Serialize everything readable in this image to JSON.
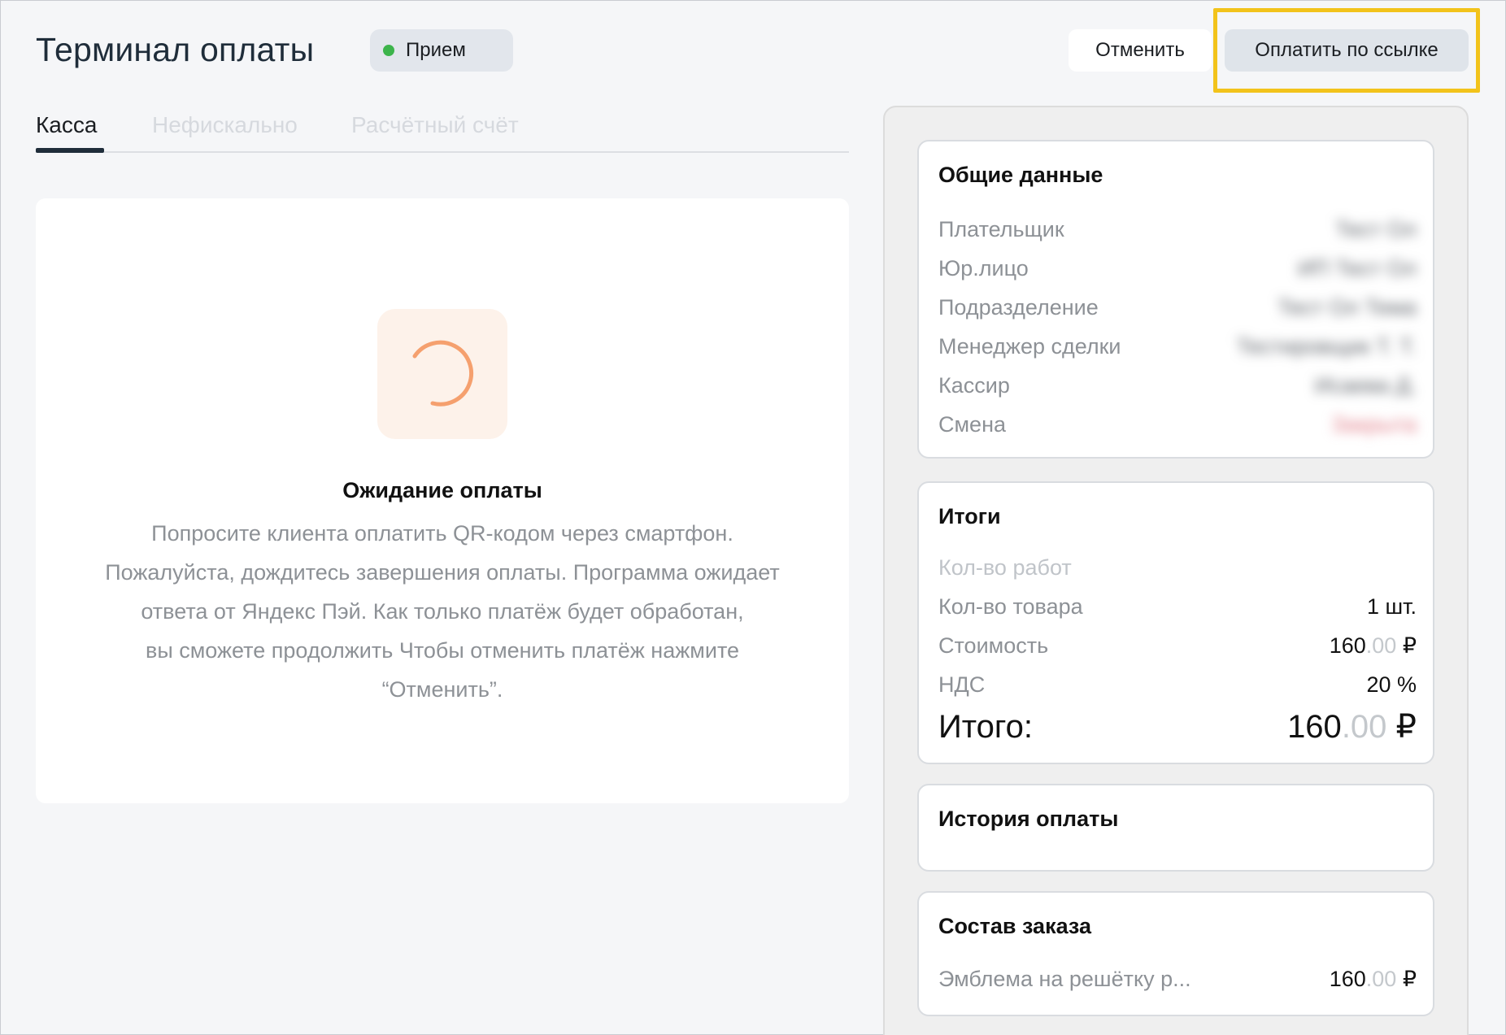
{
  "header": {
    "title": "Терминал оплаты",
    "status": {
      "label": "Прием",
      "dot_color": "#3cb44b"
    },
    "cancel_label": "Отменить",
    "pay_link_label": "Оплатить по ссылке",
    "highlight_color": "#f2c31b"
  },
  "tabs": [
    {
      "label": "Касса",
      "active": true
    },
    {
      "label": "Нефискально",
      "active": false
    },
    {
      "label": "Расчётный счёт",
      "active": false
    }
  ],
  "waiting": {
    "spinner_color": "#f5a06e",
    "title": "Ожидание оплаты",
    "lines": [
      "Попросите клиента оплатить QR-кодом через смартфон.",
      "Пожалуйста, дождитесь завершения оплаты. Программа ожидает",
      "ответа от Яндекс Пэй. Как только платёж будет обработан,",
      "вы сможете продолжить Чтобы отменить платёж нажмите",
      "“Отменить”."
    ]
  },
  "general": {
    "title": "Общие данные",
    "rows": [
      {
        "label": "Плательщик",
        "value": "Тест Ол"
      },
      {
        "label": "Юр.лицо",
        "value": "ИП Тест Ол"
      },
      {
        "label": "Подразделение",
        "value": "Тест Ол Тема"
      },
      {
        "label": "Менеджер сделки",
        "value": "Тестировщик Т. Т."
      },
      {
        "label": "Кассир",
        "value": "Исаева Д."
      },
      {
        "label": "Смена",
        "value": "Закрыта"
      }
    ]
  },
  "totals": {
    "title": "Итоги",
    "works_label": "Кол-во работ",
    "goods_label": "Кол-во товара",
    "goods_value": "1 шт.",
    "cost_label": "Стоимость",
    "cost_main": "160",
    "cost_cents": ".00",
    "currency": "₽",
    "vat_label": "НДС",
    "vat_value": "20 %",
    "total_label": "Итого:",
    "total_main": "160",
    "total_cents": ".00"
  },
  "history": {
    "title": "История оплаты"
  },
  "order": {
    "title": "Состав заказа",
    "item_name": "Эмблема на решётку р...",
    "item_main": "160",
    "item_cents": ".00",
    "currency": "₽"
  }
}
